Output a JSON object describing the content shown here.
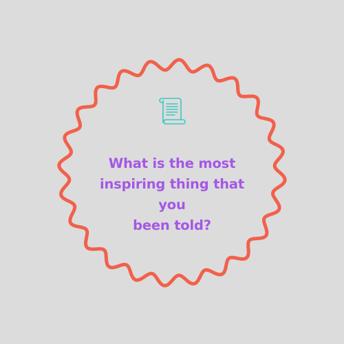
{
  "colors": {
    "background": "#dcdcdc",
    "frame": "#f1614c",
    "icon": "#3cc8c4",
    "question_text": "#a557e6"
  },
  "frame": {
    "shape": "wavy-circle",
    "waves": 24
  },
  "icon": {
    "name": "scroll-icon"
  },
  "question": {
    "text": "What is the most\ninspiring thing that you\nbeen told?"
  }
}
